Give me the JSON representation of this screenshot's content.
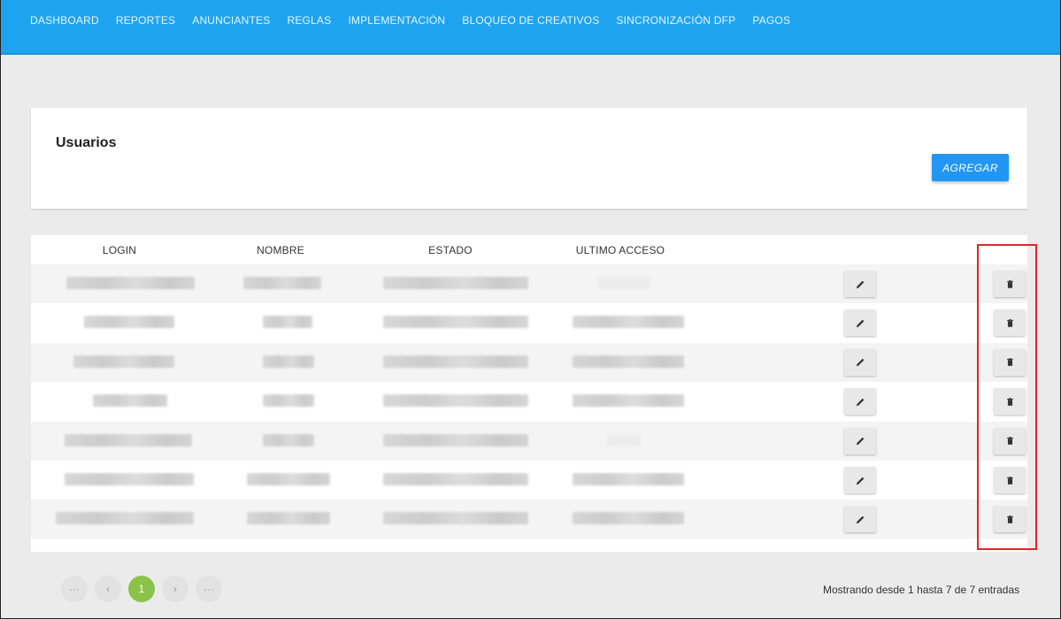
{
  "nav": {
    "items": [
      {
        "label": "DASHBOARD"
      },
      {
        "label": "REPORTES"
      },
      {
        "label": "ANUNCIANTES"
      },
      {
        "label": "REGLAS"
      },
      {
        "label": "IMPLEMENTACIÓN"
      },
      {
        "label": "BLOQUEO DE CREATIVOS"
      },
      {
        "label": "SINCRONIZACIÓN DFP"
      },
      {
        "label": "PAGOS"
      }
    ]
  },
  "header": {
    "title": "Usuarios",
    "add_label": "AGREGAR"
  },
  "table": {
    "columns": [
      "LOGIN",
      "NOMBRE",
      "ESTADO",
      "ULTIMO ACCESO"
    ],
    "row_count": 7
  },
  "pagination": {
    "first": "···",
    "prev": "‹",
    "current": "1",
    "next": "›",
    "last": "···"
  },
  "info": {
    "entries_text": "Mostrando desde 1 hasta 7 de 7 entradas"
  },
  "colors": {
    "navbar": "#1ea4ef",
    "accent": "#2196f3",
    "pager_active": "#8bc34a",
    "highlight": "#e3242b"
  }
}
